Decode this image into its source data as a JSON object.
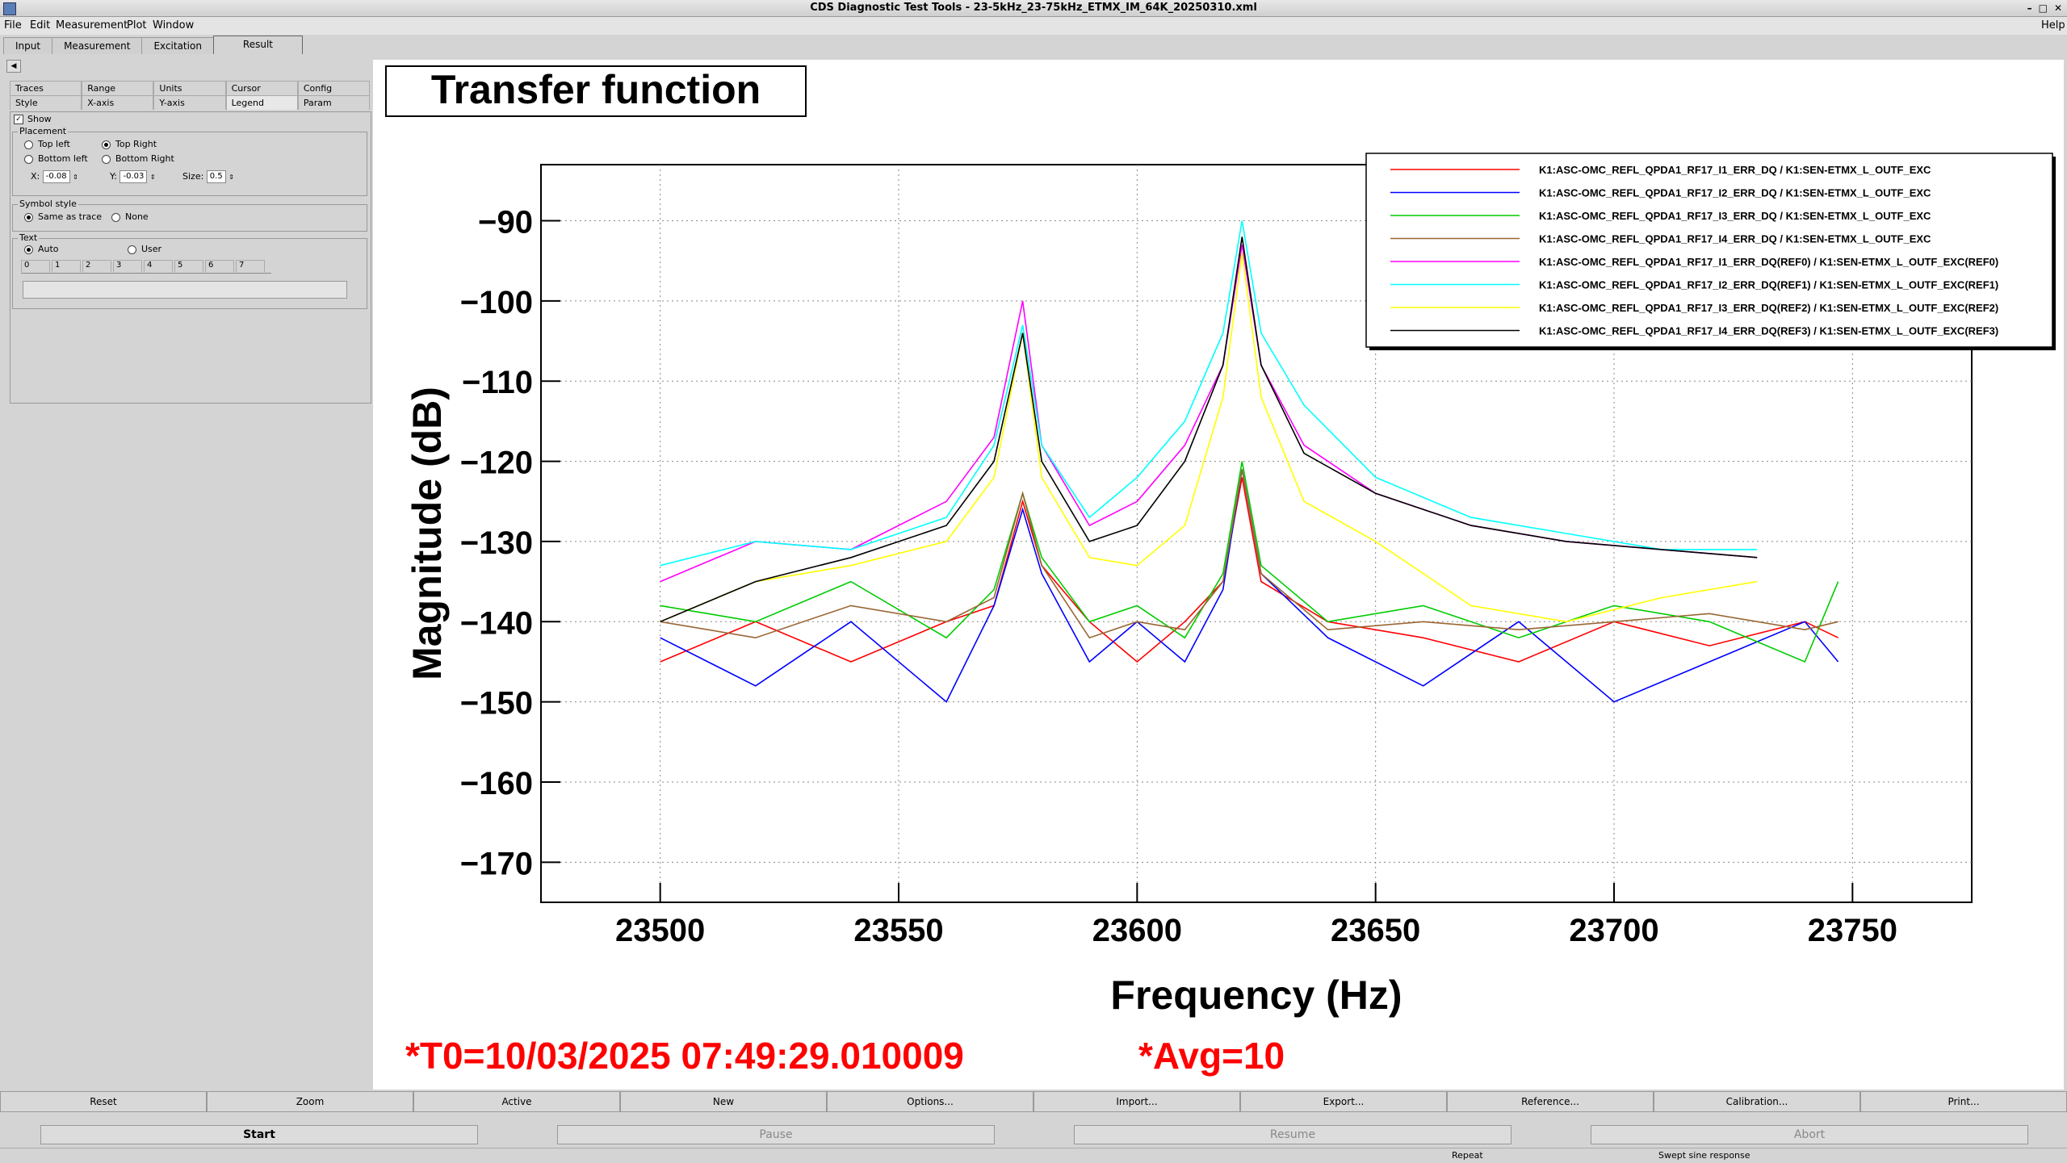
{
  "window": {
    "title": "CDS Diagnostic Test Tools - 23-5kHz_23-75kHz_ETMX_IM_64K_20250310.xml"
  },
  "menu": {
    "file": "File",
    "edit": "Edit",
    "measurement": "Measurement",
    "plot": "Plot",
    "window": "Window",
    "help": "Help"
  },
  "tabs": {
    "input": "Input",
    "measurement": "Measurement",
    "excitation": "Excitation",
    "result": "Result"
  },
  "subtabs": {
    "traces": "Traces",
    "range": "Range",
    "units": "Units",
    "cursor": "Cursor",
    "config": "Config",
    "style": "Style",
    "xaxis": "X-axis",
    "yaxis": "Y-axis",
    "legend": "Legend",
    "param": "Param"
  },
  "legend_panel": {
    "show": "Show",
    "placement": "Placement",
    "top_left": "Top left",
    "top_right": "Top Right",
    "bottom_left": "Bottom left",
    "bottom_right": "Bottom Right",
    "x_label": "X:",
    "x_value": "-0.08",
    "y_label": "Y:",
    "y_value": "-0.03",
    "size_label": "Size:",
    "size_value": "0.5",
    "symbol_style": "Symbol style",
    "same_as_trace": "Same as trace",
    "none": "None",
    "text": "Text",
    "auto": "Auto",
    "user": "User",
    "text_tabs": [
      "0",
      "1",
      "2",
      "3",
      "4",
      "5",
      "6",
      "7"
    ]
  },
  "buttons": {
    "reset": "Reset",
    "zoom": "Zoom",
    "active": "Active",
    "new": "New",
    "options": "Options...",
    "import": "Import...",
    "export": "Export...",
    "reference": "Reference...",
    "calibration": "Calibration...",
    "print": "Print..."
  },
  "controls": {
    "start": "Start",
    "pause": "Pause",
    "resume": "Resume",
    "abort": "Abort"
  },
  "status": {
    "repeat": "Repeat",
    "mode": "Swept sine response"
  },
  "colors": {
    "red": "#ff0000",
    "blue": "#0000ff",
    "green": "#00cc00",
    "brown": "#996633",
    "magenta": "#ff00ff",
    "cyan": "#00ffff",
    "yellow": "#ffff00",
    "black": "#000000"
  },
  "chart_data": {
    "type": "line",
    "title": "Transfer function",
    "xlabel": "Frequency (Hz)",
    "ylabel": "Magnitude (dB)",
    "xlim": [
      23475,
      23775
    ],
    "ylim": [
      -175,
      -83
    ],
    "xticks": [
      23500,
      23550,
      23600,
      23650,
      23700,
      23750
    ],
    "yticks": [
      -90,
      -100,
      -110,
      -120,
      -130,
      -140,
      -150,
      -160,
      -170
    ],
    "grid": true,
    "legend_position": "top-right",
    "annotations": {
      "t0": "*T0=10/03/2025 07:49:29.010009",
      "avg": "*Avg=10"
    },
    "series": [
      {
        "name": "K1:ASC-OMC_REFL_QPDA1_RF17_I1_ERR_DQ / K1:SEN-ETMX_L_OUTF_EXC",
        "color": "#ff0000",
        "x": [
          23500,
          23520,
          23540,
          23560,
          23570,
          23576,
          23580,
          23590,
          23600,
          23610,
          23618,
          23622,
          23626,
          23640,
          23660,
          23680,
          23700,
          23720,
          23740,
          23747
        ],
        "y": [
          -145,
          -140,
          -145,
          -140,
          -138,
          -125,
          -133,
          -140,
          -145,
          -140,
          -135,
          -122,
          -135,
          -140,
          -142,
          -145,
          -140,
          -143,
          -140,
          -142
        ]
      },
      {
        "name": "K1:ASC-OMC_REFL_QPDA1_RF17_I2_ERR_DQ / K1:SEN-ETMX_L_OUTF_EXC",
        "color": "#0000ff",
        "x": [
          23500,
          23520,
          23540,
          23560,
          23570,
          23576,
          23580,
          23590,
          23600,
          23610,
          23618,
          23622,
          23626,
          23640,
          23660,
          23680,
          23700,
          23720,
          23740,
          23747
        ],
        "y": [
          -142,
          -148,
          -140,
          -150,
          -138,
          -126,
          -134,
          -145,
          -140,
          -145,
          -136,
          -121,
          -134,
          -142,
          -148,
          -140,
          -150,
          -145,
          -140,
          -145
        ]
      },
      {
        "name": "K1:ASC-OMC_REFL_QPDA1_RF17_I3_ERR_DQ / K1:SEN-ETMX_L_OUTF_EXC",
        "color": "#00cc00",
        "x": [
          23500,
          23520,
          23540,
          23560,
          23570,
          23576,
          23580,
          23590,
          23600,
          23610,
          23618,
          23622,
          23626,
          23640,
          23660,
          23680,
          23700,
          23720,
          23740,
          23747
        ],
        "y": [
          -138,
          -140,
          -135,
          -142,
          -136,
          -124,
          -132,
          -140,
          -138,
          -142,
          -134,
          -120,
          -133,
          -140,
          -138,
          -142,
          -138,
          -140,
          -145,
          -135
        ]
      },
      {
        "name": "K1:ASC-OMC_REFL_QPDA1_RF17_I4_ERR_DQ / K1:SEN-ETMX_L_OUTF_EXC",
        "color": "#996633",
        "x": [
          23500,
          23520,
          23540,
          23560,
          23570,
          23576,
          23580,
          23590,
          23600,
          23610,
          23618,
          23622,
          23626,
          23640,
          23660,
          23680,
          23700,
          23720,
          23740,
          23747
        ],
        "y": [
          -140,
          -142,
          -138,
          -140,
          -137,
          -124,
          -133,
          -142,
          -140,
          -141,
          -135,
          -121,
          -134,
          -141,
          -140,
          -141,
          -140,
          -139,
          -141,
          -140
        ]
      },
      {
        "name": "K1:ASC-OMC_REFL_QPDA1_RF17_I1_ERR_DQ(REF0) / K1:SEN-ETMX_L_OUTF_EXC(REF0)",
        "color": "#ff00ff",
        "x": [
          23500,
          23520,
          23540,
          23560,
          23570,
          23576,
          23580,
          23590,
          23600,
          23610,
          23618,
          23622,
          23626,
          23635,
          23650,
          23670,
          23690,
          23710,
          23730
        ],
        "y": [
          -135,
          -130,
          -131,
          -125,
          -117,
          -100,
          -118,
          -128,
          -125,
          -118,
          -108,
          -93,
          -108,
          -118,
          -124,
          -128,
          -130,
          -131,
          -132
        ]
      },
      {
        "name": "K1:ASC-OMC_REFL_QPDA1_RF17_I2_ERR_DQ(REF1) / K1:SEN-ETMX_L_OUTF_EXC(REF1)",
        "color": "#00ffff",
        "x": [
          23500,
          23520,
          23540,
          23560,
          23570,
          23576,
          23580,
          23590,
          23600,
          23610,
          23618,
          23622,
          23626,
          23635,
          23650,
          23670,
          23690,
          23710,
          23730
        ],
        "y": [
          -133,
          -130,
          -131,
          -127,
          -118,
          -103,
          -118,
          -127,
          -122,
          -115,
          -104,
          -90,
          -104,
          -113,
          -122,
          -127,
          -129,
          -131,
          -131
        ]
      },
      {
        "name": "K1:ASC-OMC_REFL_QPDA1_RF17_I3_ERR_DQ(REF2) / K1:SEN-ETMX_L_OUTF_EXC(REF2)",
        "color": "#ffff00",
        "x": [
          23500,
          23520,
          23540,
          23560,
          23570,
          23576,
          23580,
          23590,
          23600,
          23610,
          23618,
          23622,
          23626,
          23635,
          23650,
          23670,
          23690,
          23710,
          23730
        ],
        "y": [
          -140,
          -135,
          -133,
          -130,
          -122,
          -104,
          -122,
          -132,
          -133,
          -128,
          -112,
          -94,
          -112,
          -125,
          -130,
          -138,
          -140,
          -137,
          -135
        ]
      },
      {
        "name": "K1:ASC-OMC_REFL_QPDA1_RF17_I4_ERR_DQ(REF3) / K1:SEN-ETMX_L_OUTF_EXC(REF3)",
        "color": "#000000",
        "x": [
          23500,
          23520,
          23540,
          23560,
          23570,
          23576,
          23580,
          23590,
          23600,
          23610,
          23618,
          23622,
          23626,
          23635,
          23650,
          23670,
          23690,
          23710,
          23730
        ],
        "y": [
          -140,
          -135,
          -132,
          -128,
          -120,
          -104,
          -120,
          -130,
          -128,
          -120,
          -108,
          -92,
          -108,
          -119,
          -124,
          -128,
          -130,
          -131,
          -132
        ]
      }
    ]
  }
}
